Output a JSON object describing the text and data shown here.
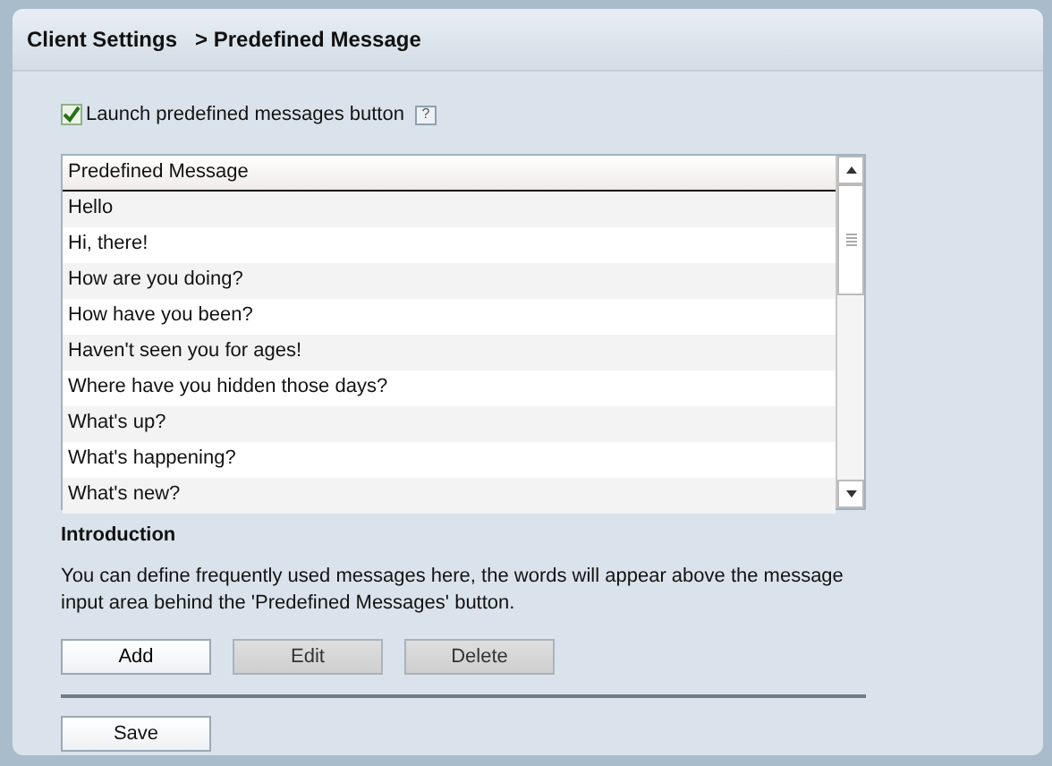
{
  "breadcrumb": {
    "section": "Client Settings",
    "page": "> Predefined Message"
  },
  "launch_option": {
    "label": "Launch predefined messages button",
    "checked": true,
    "help": "?"
  },
  "messages_table": {
    "column": "Predefined Message",
    "rows": [
      {
        "text": "Hello"
      },
      {
        "text": "Hi, there!"
      },
      {
        "text": "How are you doing?"
      },
      {
        "text": "How have you been?"
      },
      {
        "text": "Haven't seen you for ages!"
      },
      {
        "text": "Where have you hidden those days?"
      },
      {
        "text": "What's up?"
      },
      {
        "text": "What's happening?"
      },
      {
        "text": "What's new?"
      }
    ]
  },
  "introduction": {
    "title": "Introduction",
    "text": "You can define frequently used messages here, the words will appear above the message input area behind the 'Predefined Messages' button."
  },
  "buttons": [
    {
      "label": "Add",
      "disabled": false
    },
    {
      "label": "Edit",
      "disabled": true
    },
    {
      "label": "Delete",
      "disabled": true
    }
  ],
  "save": {
    "label": "Save"
  }
}
